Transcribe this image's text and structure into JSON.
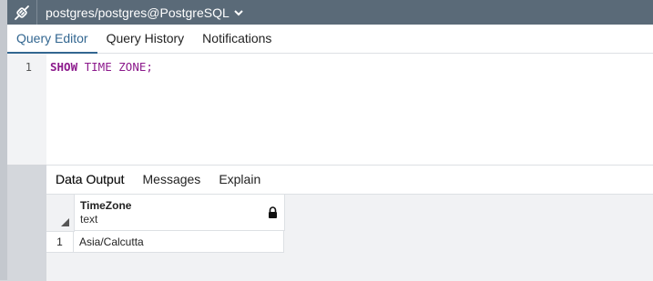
{
  "connection": {
    "label": "postgres/postgres@PostgreSQL",
    "icon": "plug-icon"
  },
  "editor_tabs": [
    {
      "label": "Query Editor"
    },
    {
      "label": "Query History"
    },
    {
      "label": "Notifications"
    }
  ],
  "editor": {
    "line_number": "1",
    "keyword1": "SHOW",
    "rest": " TIME ZONE;"
  },
  "result_tabs": [
    {
      "label": "Data Output"
    },
    {
      "label": "Messages"
    },
    {
      "label": "Explain"
    }
  ],
  "grid": {
    "column": {
      "name": "TimeZone",
      "type": "text"
    },
    "rows": [
      {
        "num": "1",
        "value": "Asia/Calcutta"
      }
    ]
  },
  "colors": {
    "accent": "#326690",
    "topbar": "#5a6a78",
    "keyword": "#8c1a8c"
  }
}
